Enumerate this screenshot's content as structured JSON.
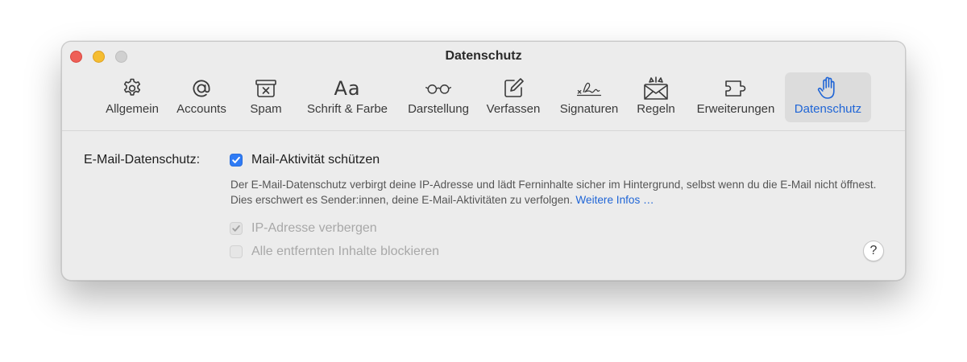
{
  "window": {
    "title": "Datenschutz"
  },
  "toolbar": {
    "items": [
      {
        "label": "Allgemein",
        "icon": "gear-icon"
      },
      {
        "label": "Accounts",
        "icon": "at-sign-icon"
      },
      {
        "label": "Spam",
        "icon": "junk-tray-icon"
      },
      {
        "label": "Schrift & Farbe",
        "icon": "font-aa-icon",
        "glyph": "Aa"
      },
      {
        "label": "Darstellung",
        "icon": "glasses-icon"
      },
      {
        "label": "Verfassen",
        "icon": "compose-icon"
      },
      {
        "label": "Signaturen",
        "icon": "signature-icon"
      },
      {
        "label": "Regeln",
        "icon": "envelope-rules-icon"
      },
      {
        "label": "Erweiterungen",
        "icon": "puzzle-icon"
      },
      {
        "label": "Datenschutz",
        "icon": "hand-icon",
        "active": true
      }
    ]
  },
  "privacy": {
    "section_label": "E-Mail-Datenschutz:",
    "protect_label": "Mail-Aktivität schützen",
    "protect_checked": true,
    "description": "Der E-Mail-Datenschutz verbirgt deine IP-Adresse und lädt Ferninhalte sicher im Hintergrund, selbst wenn du die E-Mail nicht öffnest. Dies erschwert es Sender:innen, deine E-Mail-Aktivitäten zu verfolgen.",
    "more_link": "Weitere Infos …",
    "hide_ip_label": "IP-Adresse verbergen",
    "hide_ip_checked": true,
    "block_remote_label": "Alle entfernten Inhalte blockieren",
    "block_remote_checked": false,
    "help_label": "?"
  },
  "colors": {
    "accent": "#2f7bf5",
    "link": "#1f65d6",
    "close": "#ee5f57",
    "minimize": "#f5bd31",
    "zoom_inactive": "#d0d0d0"
  }
}
